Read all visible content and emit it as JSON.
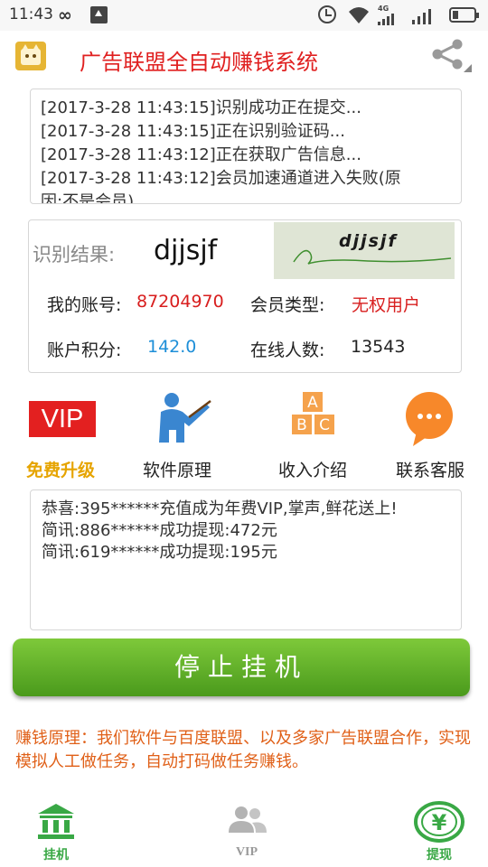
{
  "status_bar": {
    "time": "11:43",
    "network": "4G"
  },
  "header": {
    "title": "广告联盟全自动赚钱系统"
  },
  "log": {
    "lines": [
      "[2017-3-28 11:43:15]识别成功正在提交...",
      "[2017-3-28 11:43:15]正在识别验证码...",
      "[2017-3-28 11:43:12]正在获取广告信息...",
      "[2017-3-28 11:43:12]会员加速通道进入失败(原",
      "因:不是会员)"
    ]
  },
  "recognition": {
    "label": "识别结果:",
    "value": "djjsjf",
    "captcha_text": "djjsjf"
  },
  "account": {
    "account_label": "我的账号:",
    "account_value": "87204970",
    "member_type_label": "会员类型:",
    "member_type_value": "无权用户",
    "points_label": "账户积分:",
    "points_value": "142.0",
    "online_label": "在线人数:",
    "online_value": "13543"
  },
  "features": [
    {
      "icon": "vip-icon",
      "icon_text": "VIP",
      "label": "免费升级",
      "color": "#e6a400"
    },
    {
      "icon": "teacher-icon",
      "label": "软件原理"
    },
    {
      "icon": "abc-blocks-icon",
      "label": "收入介绍"
    },
    {
      "icon": "chat-bubble-icon",
      "label": "联系客服"
    }
  ],
  "messages": {
    "lines": [
      "恭喜:395******充值成为年费VIP,掌声,鲜花送上!",
      "简讯:886******成功提现:472元",
      "简讯:619******成功提现:195元"
    ]
  },
  "stop_button": {
    "label": "停止挂机"
  },
  "principle": {
    "text": "赚钱原理：我们软件与百度联盟、以及多家广告联盟合作，实现模拟人工做任务，自动打码做任务赚钱。"
  },
  "bottom_nav": {
    "items": [
      {
        "label": "挂机",
        "icon": "bank-icon",
        "active": true
      },
      {
        "label": "VIP",
        "icon": "users-icon",
        "active": false
      },
      {
        "label": "提现",
        "icon": "yuan-icon",
        "active": true
      }
    ]
  },
  "colors": {
    "title_red": "#e02020",
    "accent_green": "#5aaa22",
    "principle_orange": "#e06018",
    "points_blue": "#1e8fd8",
    "vip_gold": "#e6a400"
  }
}
